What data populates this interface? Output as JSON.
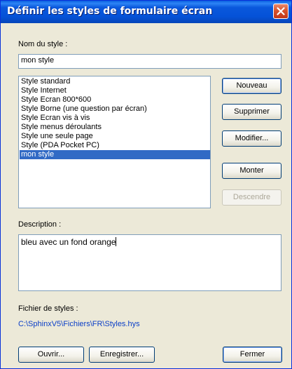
{
  "window": {
    "title": "Définir les styles de formulaire écran",
    "close_icon": "close-icon"
  },
  "style_name": {
    "label": "Nom du style :",
    "value": "mon style"
  },
  "styles_list": {
    "items": [
      "Style standard",
      "Style Internet",
      "Style Ecran 800*600",
      "Style Borne (une question par écran)",
      "Style Ecran vis à vis",
      "Style menus déroulants",
      "Style une seule page",
      "Style (PDA Pocket PC)",
      "mon style"
    ],
    "selected_index": 8,
    "selection_color": "#316ac5"
  },
  "buttons": {
    "new": "Nouveau",
    "delete": "Supprimer",
    "modify": "Modifier...",
    "up": "Monter",
    "down": "Descendre"
  },
  "description": {
    "label": "Description :",
    "value": "bleu avec un fond orange"
  },
  "styles_file": {
    "label": "Fichier de styles :",
    "path": "C:\\SphinxV5\\Fichiers\\FR\\Styles.hys",
    "link_color": "#0a3ec7"
  },
  "footer": {
    "open": "Ouvrir...",
    "save": "Enregistrer...",
    "close": "Fermer"
  }
}
